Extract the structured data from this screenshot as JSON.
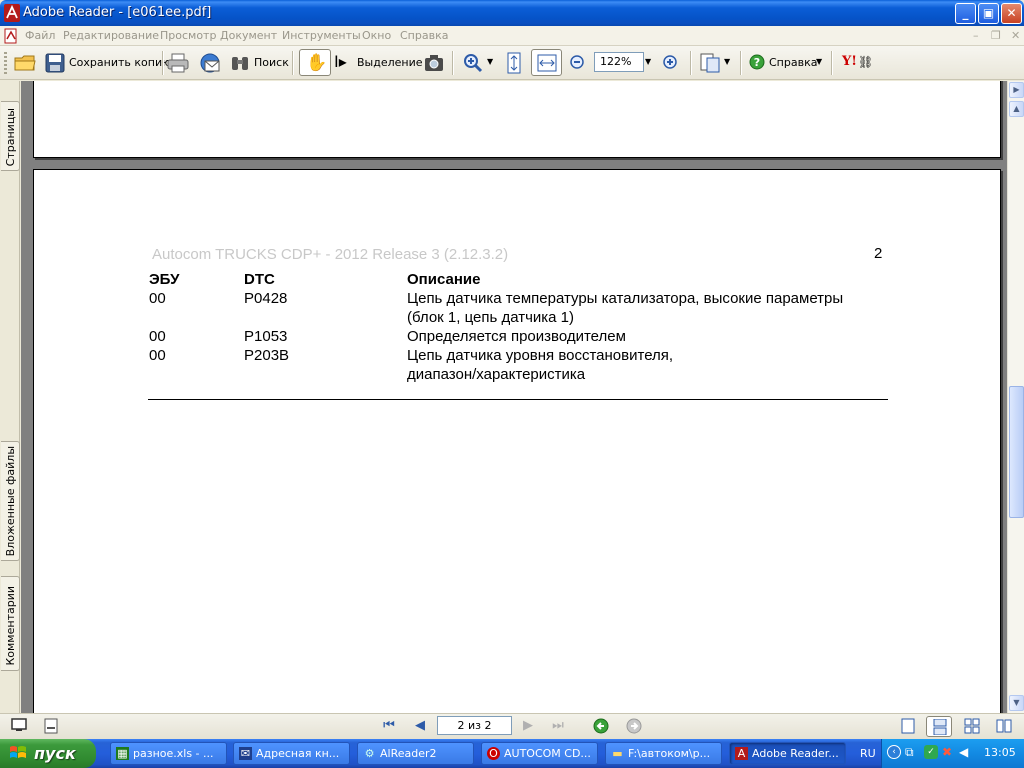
{
  "window": {
    "title": "Adobe Reader - [e061ee.pdf]",
    "controls": {
      "minimize": "_",
      "maximize": "▣",
      "close": "✕"
    }
  },
  "menu": {
    "items": [
      "Файл",
      "Редактирование",
      "Просмотр",
      "Документ",
      "Инструменты",
      "Окно",
      "Справка"
    ]
  },
  "toolbar": {
    "save_copy_label": "Сохранить копию",
    "search_label": "Поиск",
    "select_label": "Выделение",
    "zoom_value": "122%",
    "help_label": "Справка",
    "yahoo_label": "Y!"
  },
  "side_panel": {
    "tabs": [
      "Страницы",
      "Вложенные файлы",
      "Комментарии"
    ]
  },
  "document": {
    "header_left": "Autocom TRUCKS CDP+ - 2012 Release 3 (2.12.3.2)",
    "page_number": "2",
    "table": {
      "columns": [
        "ЭБУ",
        "DTC",
        "Описание"
      ],
      "rows": [
        {
          "ecu": "00",
          "dtc": "P0428",
          "desc_line1": "Цепь датчика температуры катализатора, высокие параметры",
          "desc_line2": "(блок 1, цепь датчика 1)"
        },
        {
          "ecu": "00",
          "dtc": "P1053",
          "desc_line1": "Определяется производителем",
          "desc_line2": ""
        },
        {
          "ecu": "00",
          "dtc": "P203B",
          "desc_line1": "Цепь датчика уровня восстановителя,",
          "desc_line2": "диапазон/характеристика"
        }
      ]
    }
  },
  "statusbar": {
    "page_indicator": "2 из 2"
  },
  "taskbar": {
    "start_label": "пуск",
    "tasks": [
      {
        "label": "разное.xls - ...",
        "active": false
      },
      {
        "label": "Адресная кн...",
        "active": false
      },
      {
        "label": "AlReader2",
        "active": false
      },
      {
        "label": "AUTOCOM CD...",
        "active": false
      },
      {
        "label": "F:\\автоком\\р...",
        "active": false
      },
      {
        "label": "Adobe Reader...",
        "active": true
      }
    ],
    "language": "RU",
    "clock": "13:05"
  },
  "colors": {
    "titlebar": "#0b5ed7",
    "taskbar": "#245edb",
    "start_button": "#3c9a3c",
    "tray": "#138ae3",
    "document_bg": "#808080"
  }
}
